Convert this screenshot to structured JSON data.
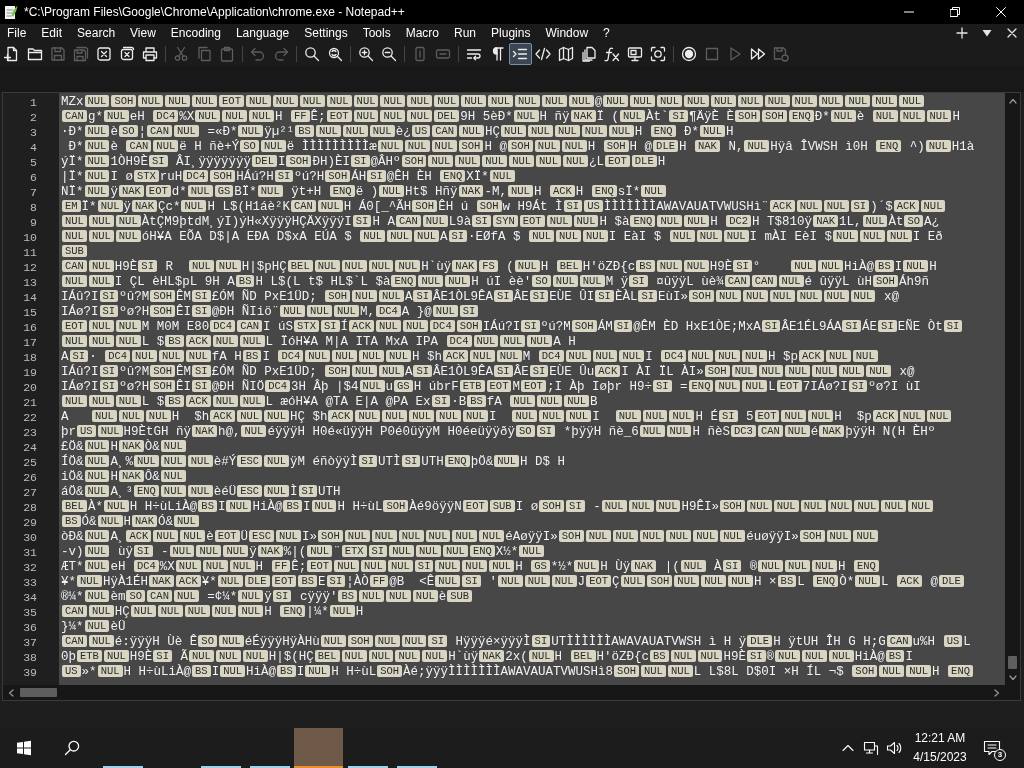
{
  "window": {
    "title": "*C:\\Program Files\\Google\\Chrome\\Application\\chrome.exe - Notepad++"
  },
  "menu": [
    "File",
    "Edit",
    "Search",
    "View",
    "Encoding",
    "Language",
    "Settings",
    "Tools",
    "Macro",
    "Run",
    "Plugins",
    "Window",
    "?"
  ],
  "toolbar": {
    "groups": [
      {
        "items": [
          {
            "kind": "new",
            "disabled": false,
            "on": false
          },
          {
            "kind": "open",
            "disabled": false,
            "on": false
          },
          {
            "kind": "save",
            "disabled": true,
            "on": false
          },
          {
            "kind": "save-all",
            "disabled": true,
            "on": false
          },
          {
            "kind": "close",
            "disabled": false,
            "on": false
          },
          {
            "kind": "close-all",
            "disabled": false,
            "on": false
          },
          {
            "kind": "print",
            "disabled": false,
            "on": false
          }
        ]
      },
      {
        "items": [
          {
            "kind": "cut",
            "disabled": true,
            "on": false
          },
          {
            "kind": "copy",
            "disabled": true,
            "on": false
          },
          {
            "kind": "paste",
            "disabled": true,
            "on": false
          }
        ]
      },
      {
        "items": [
          {
            "kind": "undo",
            "disabled": true,
            "on": false
          },
          {
            "kind": "redo",
            "disabled": true,
            "on": false
          }
        ]
      },
      {
        "items": [
          {
            "kind": "find",
            "disabled": false,
            "on": false
          },
          {
            "kind": "replace",
            "disabled": false,
            "on": false
          }
        ]
      },
      {
        "items": [
          {
            "kind": "zoom-in",
            "disabled": false,
            "on": false
          },
          {
            "kind": "zoom-out",
            "disabled": false,
            "on": false
          }
        ]
      },
      {
        "items": [
          {
            "kind": "sync-vertical",
            "disabled": true,
            "on": false
          },
          {
            "kind": "sync-horizontal",
            "disabled": true,
            "on": false
          }
        ]
      },
      {
        "items": [
          {
            "kind": "wrap",
            "disabled": false,
            "on": false
          },
          {
            "kind": "all-chars",
            "disabled": false,
            "on": false
          },
          {
            "kind": "indent-guide",
            "disabled": false,
            "on": true
          },
          {
            "kind": "tags",
            "disabled": false,
            "on": false
          },
          {
            "kind": "doc-map",
            "disabled": false,
            "on": false
          },
          {
            "kind": "doc-list",
            "disabled": false,
            "on": false
          },
          {
            "kind": "function-list",
            "disabled": false,
            "on": false
          },
          {
            "kind": "workspace",
            "disabled": false,
            "on": false
          },
          {
            "kind": "monitoring",
            "disabled": false,
            "on": false
          }
        ]
      },
      {
        "items": [
          {
            "kind": "record",
            "disabled": false,
            "on": false
          },
          {
            "kind": "stop",
            "disabled": true,
            "on": false
          },
          {
            "kind": "play",
            "disabled": true,
            "on": false
          },
          {
            "kind": "play-multiple",
            "disabled": false,
            "on": false
          },
          {
            "kind": "save-macro",
            "disabled": true,
            "on": false
          }
        ]
      }
    ]
  },
  "editor": {
    "all_selected": true,
    "lines": [
      {
        "number": "1",
        "segments": [
          "MZx",
          [
            "NUL"
          ],
          [
            "SOH"
          ],
          [
            "NUL"
          ],
          [
            "NUL"
          ],
          [
            "NUL"
          ],
          [
            "EOT"
          ],
          [
            "NUL"
          ],
          [
            "NUL"
          ],
          [
            "NUL"
          ],
          [
            "NUL"
          ],
          [
            "NUL"
          ],
          [
            "NUL"
          ],
          [
            "NUL"
          ],
          [
            "NUL"
          ],
          [
            "NUL"
          ],
          [
            "NUL"
          ],
          [
            "NUL"
          ],
          [
            "NUL"
          ],
          [
            "NUL"
          ],
          "@",
          [
            "NUL"
          ],
          [
            "NUL"
          ],
          [
            "NUL"
          ],
          [
            "NUL"
          ],
          [
            "NUL"
          ],
          [
            "NUL"
          ],
          [
            "NUL"
          ],
          [
            "NUL"
          ],
          [
            "NUL"
          ],
          [
            "NUL"
          ],
          [
            "NUL"
          ],
          [
            "NUL"
          ]
        ]
      },
      {
        "number": "2",
        "segments": [
          [
            "CAN"
          ],
          "g*",
          [
            "NUL"
          ],
          "eH ",
          [
            "DC4"
          ],
          "%X",
          [
            "NUL"
          ],
          [
            "NUL"
          ],
          [
            "NUL"
          ],
          "H ",
          [
            "FF"
          ],
          "Ê;",
          [
            "EOT"
          ],
          [
            "NUL"
          ],
          [
            "NUL"
          ],
          [
            "NUL"
          ],
          [
            "DEL"
          ],
          "9H 5èÐ*",
          [
            "NUL"
          ],
          "H ñÿ",
          [
            "NAK"
          ],
          "Ï (",
          [
            "NUL"
          ],
          "Àt`",
          [
            "SI"
          ],
          "¶ÄÿÈ È",
          [
            "SOH"
          ],
          [
            "SOH"
          ],
          [
            "ENQ"
          ],
          "Ð*",
          [
            "NUL"
          ],
          "è ",
          [
            "NUL"
          ],
          [
            "NUL"
          ],
          [
            "NUL"
          ],
          "H"
        ]
      },
      {
        "number": "3",
        "segments": [
          "·Ð*",
          [
            "NUL"
          ],
          "è",
          [
            "SO"
          ],
          "¦",
          [
            "CAN"
          ],
          [
            "NUL"
          ],
          " =«Ð*",
          [
            "NUL"
          ],
          "ÿµ²¹",
          [
            "BS"
          ],
          [
            "NUL"
          ],
          [
            "NUL"
          ],
          [
            "NUL"
          ],
          "è¿",
          [
            "US"
          ],
          [
            "CAN"
          ],
          [
            "NUL"
          ],
          "HÇ",
          [
            "NUL"
          ],
          [
            "NUL"
          ],
          [
            "NUL"
          ],
          [
            "NUL"
          ],
          [
            "NUL"
          ],
          "H ",
          [
            "ENQ"
          ],
          " Ð*",
          [
            "NUL"
          ],
          "H"
        ]
      },
      {
        "number": "4",
        "segments": [
          " Ð*",
          [
            "NUL"
          ],
          "è ",
          [
            "CAN"
          ],
          [
            "NUL"
          ],
          "ë H ñè+Ý",
          [
            "SO"
          ],
          [
            "NUL"
          ],
          "ë ÌÌÌÌÌÌÌÌÌæ",
          [
            "NUL"
          ],
          [
            "NUL"
          ],
          [
            "NUL"
          ],
          [
            "SOH"
          ],
          "H @",
          [
            "SOH"
          ],
          [
            "NUL"
          ],
          [
            "NUL"
          ],
          "H ",
          [
            "SOH"
          ],
          "H @",
          [
            "DLE"
          ],
          "H ",
          [
            "NAK"
          ],
          " N,",
          [
            "NUL"
          ],
          "Hÿâ ÎVWSH ì0H ",
          [
            "ENQ"
          ],
          " ^)",
          [
            "NUL"
          ],
          "H1à"
        ]
      },
      {
        "number": "5",
        "segments": [
          "ýÏ*",
          [
            "NUL"
          ],
          "1ÒH9È",
          [
            "SI"
          ],
          " ÂI¸ÿÿÿÿÿÿÿ",
          [
            "DEL"
          ],
          "I",
          [
            "SOH"
          ],
          "ÐH)ÈI",
          [
            "SI"
          ],
          "@ÂHº",
          [
            "SOH"
          ],
          [
            "NUL"
          ],
          [
            "NUL"
          ],
          [
            "NUL"
          ],
          [
            "NUL"
          ],
          [
            "NUL"
          ],
          [
            "NUL"
          ],
          "¿L",
          [
            "EOT"
          ],
          [
            "DLE"
          ],
          "H"
        ]
      },
      {
        "number": "6",
        "segments": [
          "|Ï*",
          [
            "NUL"
          ],
          "I ø",
          [
            "STX"
          ],
          "ruH",
          [
            "DC4"
          ],
          [
            "SOH"
          ],
          "HÁú?H",
          [
            "SI"
          ],
          "ºú?H",
          [
            "SOH"
          ],
          "ÁH",
          [
            "SI"
          ],
          "@ÊH ÈH ",
          [
            "ENQ"
          ],
          "XÏ*",
          [
            "NUL"
          ]
        ]
      },
      {
        "number": "7",
        "segments": [
          "NÏ*",
          [
            "NUL"
          ],
          "ÿ",
          [
            "NAK"
          ],
          [
            "EOT"
          ],
          "d*",
          [
            "NUL"
          ],
          [
            "GS"
          ],
          "BÏ*",
          [
            "NUL"
          ],
          " ÿt+H ",
          [
            "ENQ"
          ],
          "ë )",
          [
            "NUL"
          ],
          "Ht$ Hñÿ",
          [
            "NAK"
          ],
          "-M,",
          [
            "NUL"
          ],
          "H ",
          [
            "ACK"
          ],
          "H ",
          [
            "ENQ"
          ],
          "sÏ*",
          [
            "NUL"
          ]
        ]
      },
      {
        "number": "8",
        "segments": [
          [
            "EM"
          ],
          "Ï*",
          [
            "NUL"
          ],
          "ÿ",
          [
            "NAK"
          ],
          "Çc*",
          [
            "NUL"
          ],
          "H L$(H1áè²K",
          [
            "CAN"
          ],
          [
            "NUL"
          ],
          "H Á0[_^ÃH",
          [
            "SOH"
          ],
          "ÊH ú ",
          [
            "SOH"
          ],
          "w H9Át Ì",
          [
            "SI"
          ],
          [
            "US"
          ],
          "ÌÌÌÌÌÌÌAWAVAUATVWUSHì¨",
          [
            "ACK"
          ],
          [
            "NUL"
          ],
          [
            "NUL"
          ],
          [
            "SI"
          ],
          ")´$",
          [
            "ACK"
          ],
          [
            "NUL"
          ]
        ]
      },
      {
        "number": "9",
        "segments": [
          [
            "NUL"
          ],
          [
            "NUL"
          ],
          [
            "NUL"
          ],
          "ÀtÇM9þtdM¸ýI)ýH«XÿÿÿHÇÄXÿÿÿI",
          [
            "SI"
          ],
          "H A",
          [
            "CAN"
          ],
          [
            "NUL"
          ],
          "L9à",
          [
            "SI"
          ],
          [
            "SYN"
          ],
          [
            "EOT"
          ],
          [
            "NUL"
          ],
          [
            "NUL"
          ],
          "H $à",
          [
            "ENQ"
          ],
          [
            "NUL"
          ],
          [
            "NUL"
          ],
          "H ",
          [
            "DC2"
          ],
          "H T$810ÿ",
          [
            "NAK"
          ],
          "1L,",
          [
            "NUL"
          ],
          "Àt",
          [
            "SO"
          ],
          "A¿"
        ]
      },
      {
        "number": "10",
        "segments": [
          [
            "NUL"
          ],
          [
            "NUL"
          ],
          [
            "NUL"
          ],
          "óH¥A EÕA D$|A EÐA D$xA EÚA $ ",
          [
            "NUL"
          ],
          [
            "NUL"
          ],
          [
            "NUL"
          ],
          "A",
          [
            "SI"
          ],
          "·EØfA $ ",
          [
            "NUL"
          ],
          [
            "NUL"
          ],
          [
            "NUL"
          ],
          "I EàI $ ",
          [
            "NUL"
          ],
          [
            "NUL"
          ],
          [
            "NUL"
          ],
          "I mÀI EèI $",
          [
            "NUL"
          ],
          [
            "NUL"
          ],
          [
            "NUL"
          ],
          "I Eð"
        ]
      },
      {
        "number": "11",
        "segments": [
          [
            "SUB"
          ]
        ]
      },
      {
        "number": "12",
        "segments": [
          [
            "CAN"
          ],
          [
            "NUL"
          ],
          "H9È",
          [
            "SI"
          ],
          " R  ",
          [
            "NUL"
          ],
          [
            "NUL"
          ],
          "H|$pHÇ",
          [
            "BEL"
          ],
          [
            "NUL"
          ],
          [
            "NUL"
          ],
          [
            "NUL"
          ],
          [
            "NUL"
          ],
          "H`ùÿ",
          [
            "NAK"
          ],
          [
            "FS"
          ],
          " (",
          [
            "NUL"
          ],
          "H ",
          [
            "BEL"
          ],
          "H'öZÐ{c",
          [
            "BS"
          ],
          [
            "NUL"
          ],
          [
            "NUL"
          ],
          "H9È",
          [
            "SI"
          ],
          "°    ",
          [
            "NUL"
          ],
          [
            "NUL"
          ],
          "HiÀ@",
          [
            "BS"
          ],
          "I",
          [
            "NUL"
          ],
          "H"
        ]
      },
      {
        "number": "13",
        "segments": [
          [
            "NUL"
          ],
          [
            "NUL"
          ],
          "I ÇL èHL$pL 9H A",
          [
            "BS"
          ],
          "H L$(L t$ HL$`L $à",
          [
            "ENQ"
          ],
          [
            "NUL"
          ],
          [
            "NUL"
          ],
          "H úI èè'",
          [
            "SO"
          ],
          [
            "NUL"
          ],
          [
            "NUL"
          ],
          "M ÿ",
          [
            "SI"
          ],
          " ¤ûÿÿL ùè¾",
          [
            "CAN"
          ],
          [
            "CAN"
          ],
          [
            "NUL"
          ],
          "é ûÿÿL ùH",
          [
            "SOH"
          ],
          "Áh9ñ"
        ]
      },
      {
        "number": "14",
        "segments": [
          "IÁû?I",
          [
            "SI"
          ],
          "ºû?M",
          [
            "SOH"
          ],
          "ÊM",
          [
            "SI"
          ],
          "£ÓM ÑD PxE1ÜD; ",
          [
            "SOH"
          ],
          [
            "NUL"
          ],
          [
            "NUL"
          ],
          "A",
          [
            "SI"
          ],
          "ÂE1ÒL9ÊA",
          [
            "SI"
          ],
          "ÂE",
          [
            "SI"
          ],
          "EÙE ÛI",
          [
            "SI"
          ],
          "ÈÀL",
          [
            "SI"
          ],
          "EùI»",
          [
            "SOH"
          ],
          [
            "NUL"
          ],
          [
            "NUL"
          ],
          [
            "NUL"
          ],
          [
            "NUL"
          ],
          [
            "NUL"
          ],
          [
            "NUL"
          ],
          " x@"
        ]
      },
      {
        "number": "15",
        "segments": [
          "IÁø?I",
          [
            "SI"
          ],
          "ºø?H",
          [
            "SOH"
          ],
          "ÊI",
          [
            "SI"
          ],
          "@ÐH ÑIiö¨",
          [
            "NUL"
          ],
          [
            "NUL"
          ],
          [
            "NUL"
          ],
          "M,",
          [
            "DC4"
          ],
          "A }@",
          [
            "NUL"
          ],
          [
            "SI"
          ]
        ]
      },
      {
        "number": "16",
        "segments": [
          [
            "EOT"
          ],
          [
            "NUL"
          ],
          [
            "NUL"
          ],
          "M M0M E80",
          [
            "DC4"
          ],
          [
            "CAN"
          ],
          "I úS",
          [
            "STX"
          ],
          [
            "SI"
          ],
          "Í",
          [
            "ACK"
          ],
          [
            "NUL"
          ],
          [
            "NUL"
          ],
          [
            "DC4"
          ],
          [
            "SOH"
          ],
          "IÁú?I",
          [
            "SI"
          ],
          "ºú?M",
          [
            "SOH"
          ],
          "ÁM",
          [
            "SI"
          ],
          "@ÊM ÈD HxE1ÒE;MxA",
          [
            "SI"
          ],
          "ÂE1ÉL9ÁA",
          [
            "SI"
          ],
          "ÁE",
          [
            "SI"
          ],
          "EÑE Òt",
          [
            "SI"
          ]
        ]
      },
      {
        "number": "17",
        "segments": [
          [
            "NUL"
          ],
          [
            "NUL"
          ],
          [
            "NUL"
          ],
          "L $",
          [
            "BS"
          ],
          [
            "ACK"
          ],
          [
            "NUL"
          ],
          [
            "NUL"
          ],
          "L ÏóH¥A M|A ITA MxA IPA ",
          [
            "DC4"
          ],
          [
            "NUL"
          ],
          [
            "NUL"
          ],
          [
            "NUL"
          ],
          "A H"
        ]
      },
      {
        "number": "18",
        "segments": [
          "A",
          [
            "SI"
          ],
          "· ",
          [
            "DC4"
          ],
          [
            "NUL"
          ],
          [
            "NUL"
          ],
          [
            "NUL"
          ],
          "fA H",
          [
            "BS"
          ],
          "I ",
          [
            "DC4"
          ],
          [
            "NUL"
          ],
          [
            "NUL"
          ],
          [
            "NUL"
          ],
          [
            "NUL"
          ],
          "H $h",
          [
            "ACK"
          ],
          [
            "NUL"
          ],
          [
            "NUL"
          ],
          "M ",
          [
            "DC4"
          ],
          [
            "NUL"
          ],
          [
            "NUL"
          ],
          [
            "NUL"
          ],
          "I ",
          [
            "DC4"
          ],
          [
            "NUL"
          ],
          [
            "NUL"
          ],
          [
            "NUL"
          ],
          "H $p",
          [
            "ACK"
          ],
          [
            "NUL"
          ],
          [
            "NUL"
          ]
        ]
      },
      {
        "number": "19",
        "segments": [
          "IÁû?I",
          [
            "SI"
          ],
          "ºû?M",
          [
            "SOH"
          ],
          "ÊM",
          [
            "SI"
          ],
          "£ÓM ÑD PxE1ÜD; ",
          [
            "SOH"
          ],
          [
            "NUL"
          ],
          [
            "NUL"
          ],
          "A",
          [
            "SI"
          ],
          "ÂE1ÒL9ÊA",
          [
            "SI"
          ],
          "ÂE",
          [
            "SI"
          ],
          "EÙE Ûu",
          [
            "ACK"
          ],
          "I ÀI ÏL ÀI»",
          [
            "SOH"
          ],
          [
            "NUL"
          ],
          [
            "NUL"
          ],
          [
            "NUL"
          ],
          [
            "NUL"
          ],
          [
            "NUL"
          ],
          [
            "NUL"
          ],
          " x@"
        ]
      },
      {
        "number": "20",
        "segments": [
          "IÁø?I",
          [
            "SI"
          ],
          "ºø?H",
          [
            "SOH"
          ],
          "ÊI",
          [
            "SI"
          ],
          "@ÐH ÑIÖ",
          [
            "DC4"
          ],
          "3H Âþ |$4",
          [
            "NUL"
          ],
          "u",
          [
            "GS"
          ],
          "H úbrF",
          [
            "ETB"
          ],
          [
            "EOT"
          ],
          "M",
          [
            "EOT"
          ],
          ";I Àþ Iøþr H9÷",
          [
            "SI"
          ],
          " =",
          [
            "ENQ"
          ],
          [
            "NUL"
          ],
          [
            "NUL"
          ],
          "L",
          [
            "EOT"
          ],
          "7IÁø?I",
          [
            "SI"
          ],
          "ºø?I ùI"
        ]
      },
      {
        "number": "21",
        "segments": [
          [
            "NUL"
          ],
          [
            "NUL"
          ],
          [
            "NUL"
          ],
          "L $",
          [
            "BS"
          ],
          [
            "ACK"
          ],
          [
            "NUL"
          ],
          [
            "NUL"
          ],
          "L æóH¥A @TA E|A @PA Ex",
          [
            "SI"
          ],
          "·B",
          [
            "BS"
          ],
          "fA ",
          [
            "NUL"
          ],
          [
            "NUL"
          ],
          [
            "NUL"
          ],
          "B"
        ]
      },
      {
        "number": "22",
        "segments": [
          "A   ",
          [
            "NUL"
          ],
          [
            "NUL"
          ],
          [
            "NUL"
          ],
          "H  $h",
          [
            "ACK"
          ],
          [
            "NUL"
          ],
          [
            "NUL"
          ],
          "HÇ $h",
          [
            "ACK"
          ],
          [
            "NUL"
          ],
          [
            "NUL"
          ],
          [
            "NUL"
          ],
          [
            "NUL"
          ],
          [
            "NUL"
          ],
          "I  ",
          [
            "NUL"
          ],
          [
            "NUL"
          ],
          [
            "NUL"
          ],
          "I  ",
          [
            "NUL"
          ],
          [
            "NUL"
          ],
          [
            "NUL"
          ],
          "H É",
          [
            "SI"
          ],
          " 5",
          [
            "EOT"
          ],
          [
            "NUL"
          ],
          [
            "NUL"
          ],
          "H  $p",
          [
            "ACK"
          ],
          [
            "NUL"
          ],
          [
            "NUL"
          ]
        ]
      },
      {
        "number": "23",
        "segments": [
          "þr",
          [
            "US"
          ],
          [
            "NUL"
          ],
          "H9ÈtGH ñÿ",
          [
            "NAK"
          ],
          "h@,",
          [
            "NUL"
          ],
          "éÿÿÿH H0é«üÿÿH P0é0üÿÿM H0éeüÿÿðÿ",
          [
            "SO"
          ],
          [
            "SI"
          ],
          " *þÿÿH ñè_6",
          [
            "NUL"
          ],
          [
            "NUL"
          ],
          "H ñèS",
          [
            "DC3"
          ],
          [
            "CAN"
          ],
          [
            "NUL"
          ],
          "é",
          [
            "NAK"
          ],
          "þÿÿH N(H ÈHº"
        ]
      },
      {
        "number": "24",
        "segments": [
          "£Ö&",
          [
            "NUL"
          ],
          "H",
          [
            "NAK"
          ],
          "Ò&",
          [
            "NUL"
          ]
        ]
      },
      {
        "number": "25",
        "segments": [
          "ÍÖ&",
          [
            "NUL"
          ],
          "A¸%",
          [
            "NUL"
          ],
          [
            "NUL"
          ],
          [
            "NUL"
          ],
          "è#Ý",
          [
            "ESC"
          ],
          [
            "NUL"
          ],
          "ÿM éñòÿÿÌ",
          [
            "SI"
          ],
          "UTÌ",
          [
            "SI"
          ],
          "UTH",
          [
            "ENQ"
          ],
          "þÖ&",
          [
            "NUL"
          ],
          "H D$ H"
        ]
      },
      {
        "number": "26",
        "segments": [
          "iÖ&",
          [
            "NUL"
          ],
          "H",
          [
            "NAK"
          ],
          "Ô&",
          [
            "NUL"
          ]
        ]
      },
      {
        "number": "27",
        "segments": [
          "áÖ&",
          [
            "NUL"
          ],
          "A¸³",
          [
            "ENQ"
          ],
          [
            "NUL"
          ],
          [
            "NUL"
          ],
          "èéÜ",
          [
            "ESC"
          ],
          [
            "NUL"
          ],
          "Ì",
          [
            "SI"
          ],
          "UTH"
        ]
      },
      {
        "number": "28",
        "segments": [
          [
            "BEL"
          ],
          "À*",
          [
            "NUL"
          ],
          "H H÷ùLiÀ@",
          [
            "BS"
          ],
          "I",
          [
            "NUL"
          ],
          "HiÀ@",
          [
            "BS"
          ],
          "I",
          [
            "NUL"
          ],
          "H H÷ùL",
          [
            "SOH"
          ],
          "Àé9öÿÿN",
          [
            "EOT"
          ],
          [
            "SUB"
          ],
          "I ø",
          [
            "SOH"
          ],
          [
            "SI"
          ],
          " -",
          [
            "NUL"
          ],
          [
            "NUL"
          ],
          [
            "NUL"
          ],
          "H9ÊI»",
          [
            "SOH"
          ],
          [
            "NUL"
          ],
          [
            "NUL"
          ],
          [
            "NUL"
          ],
          [
            "NUL"
          ],
          [
            "NUL"
          ],
          [
            "NUL"
          ],
          [
            "NUL"
          ]
        ]
      },
      {
        "number": "29",
        "segments": [
          [
            "BS"
          ],
          "Ó&",
          [
            "NUL"
          ],
          "H",
          [
            "NAK"
          ],
          "Ó&",
          [
            "NUL"
          ]
        ]
      },
      {
        "number": "30",
        "segments": [
          "òÐ&",
          [
            "NUL"
          ],
          "A¸",
          [
            "ACK"
          ],
          [
            "NUL"
          ],
          [
            "NUL"
          ],
          "è",
          [
            "EOT"
          ],
          "Ü",
          [
            "ESC"
          ],
          [
            "NUL"
          ],
          "I»",
          [
            "SOH"
          ],
          [
            "NUL"
          ],
          [
            "NUL"
          ],
          [
            "NUL"
          ],
          [
            "NUL"
          ],
          [
            "NUL"
          ],
          [
            "NUL"
          ],
          "éAøÿÿI»",
          [
            "SOH"
          ],
          [
            "NUL"
          ],
          [
            "NUL"
          ],
          [
            "NUL"
          ],
          [
            "NUL"
          ],
          [
            "NUL"
          ],
          [
            "NUL"
          ],
          "éuøÿÿI»",
          [
            "SOH"
          ],
          [
            "NUL"
          ],
          [
            "NUL"
          ]
        ]
      },
      {
        "number": "31",
        "segments": [
          "-v)",
          [
            "NUL"
          ],
          " ùÿ",
          [
            "SI"
          ],
          " -",
          [
            "NUL"
          ],
          [
            "NUL"
          ],
          [
            "NUL"
          ],
          "ÿ",
          [
            "NAK"
          ],
          "%|(",
          [
            "NUL"
          ],
          "¨",
          [
            "ETX"
          ],
          [
            "SI"
          ],
          [
            "NUL"
          ],
          [
            "NUL"
          ],
          [
            "NUL"
          ],
          [
            "ENQ"
          ],
          "X½*",
          [
            "NUL"
          ]
        ]
      },
      {
        "number": "32",
        "segments": [
          "ÆT*",
          [
            "NUL"
          ],
          "eH ",
          [
            "DC4"
          ],
          "%X",
          [
            "NUL"
          ],
          [
            "NUL"
          ],
          [
            "NUL"
          ],
          "H ",
          [
            "FF"
          ],
          "Ê;",
          [
            "EOT"
          ],
          [
            "NUL"
          ],
          [
            "NUL"
          ],
          [
            "NUL"
          ],
          [
            "SI"
          ],
          [
            "NUL"
          ],
          [
            "NUL"
          ],
          [
            "NUL"
          ],
          "H ",
          [
            "GS"
          ],
          "*½*",
          [
            "NUL"
          ],
          "H Ùÿ",
          [
            "NAK"
          ],
          " |(",
          [
            "NUL"
          ],
          " À",
          [
            "SI"
          ],
          " ®",
          [
            "NUL"
          ],
          [
            "NUL"
          ],
          [
            "NUL"
          ],
          "H ",
          [
            "ENQ"
          ]
        ]
      },
      {
        "number": "33",
        "segments": [
          "¥*",
          [
            "NUL"
          ],
          "HÿÀ1ÉH",
          [
            "NAK"
          ],
          [
            "ACK"
          ],
          "¥*",
          [
            "NUL"
          ],
          [
            "DLE"
          ],
          [
            "EOT"
          ],
          [
            "BS"
          ],
          "E",
          [
            "SI"
          ],
          "¦ÀÒ",
          [
            "FF"
          ],
          "@B  <Ê",
          [
            "NUL"
          ],
          [
            "SI"
          ],
          " '",
          [
            "NUL"
          ],
          [
            "NUL"
          ],
          [
            "NUL"
          ],
          "J",
          [
            "EOT"
          ],
          "Ç",
          [
            "NUL"
          ],
          [
            "SOH"
          ],
          [
            "NUL"
          ],
          [
            "NUL"
          ],
          [
            "NUL"
          ],
          "H ×",
          [
            "BS"
          ],
          "L ",
          [
            "ENQ"
          ],
          "Ò*",
          [
            "NUL"
          ],
          "L ",
          [
            "ACK"
          ],
          " @",
          [
            "DLE"
          ]
        ]
      },
      {
        "number": "34",
        "segments": [
          "®¼*",
          [
            "NUL"
          ],
          "èm",
          [
            "SO"
          ],
          [
            "CAN"
          ],
          [
            "NUL"
          ],
          " =¢¼*",
          [
            "NUL"
          ],
          "ÿ",
          [
            "SI"
          ],
          " cÿÿÿ'",
          [
            "BS"
          ],
          [
            "NUL"
          ],
          [
            "NUL"
          ],
          [
            "NUL"
          ],
          "è",
          [
            "SUB"
          ]
        ]
      },
      {
        "number": "35",
        "segments": [
          [
            "CAN"
          ],
          [
            "NUL"
          ],
          "HÇ",
          [
            "NUL"
          ],
          [
            "NUL"
          ],
          [
            "NUL"
          ],
          [
            "NUL"
          ],
          [
            "NUL"
          ],
          "H ",
          [
            "ENQ"
          ],
          "|¼*",
          [
            "NUL"
          ],
          "H"
        ]
      },
      {
        "number": "36",
        "segments": [
          "}¼*",
          [
            "NUL"
          ],
          "èÜ"
        ]
      },
      {
        "number": "37",
        "segments": [
          [
            "CAN"
          ],
          [
            "NUL"
          ],
          "é:ÿÿÿH Ùè Ê",
          [
            "SO"
          ],
          [
            "NUL"
          ],
          "éÉÿÿÿHÿÀHù",
          [
            "NUL"
          ],
          [
            "SOH"
          ],
          [
            "NUL"
          ],
          [
            "NUL"
          ],
          [
            "SI"
          ],
          " Hÿÿÿé×ÿÿÿÌ",
          [
            "SI"
          ],
          "UTÌÌÌÌÌÌAWAVAUATVWSH ì H ÿ",
          [
            "DLE"
          ],
          "H ÿtUH ÎH G H;G",
          [
            "CAN"
          ],
          "u%H ",
          [
            "US"
          ],
          "L"
        ]
      },
      {
        "number": "38",
        "segments": [
          "0þ",
          [
            "ETB"
          ],
          [
            "NUL"
          ],
          "H9È",
          [
            "SI"
          ],
          " Ã",
          [
            "NUL"
          ],
          [
            "NUL"
          ],
          [
            "NUL"
          ],
          "H|$(HÇ",
          [
            "BEL"
          ],
          [
            "NUL"
          ],
          [
            "NUL"
          ],
          [
            "NUL"
          ],
          [
            "NUL"
          ],
          "H`ùÿ",
          [
            "NAK"
          ],
          "2x(",
          [
            "NUL"
          ],
          "H ",
          [
            "BEL"
          ],
          "H'öZÐ{c",
          [
            "BS"
          ],
          [
            "NUL"
          ],
          [
            "NUL"
          ],
          "H9È",
          [
            "SI"
          ],
          "®",
          [
            "NUL"
          ],
          [
            "NUL"
          ],
          [
            "NUL"
          ],
          "HiÀ@",
          [
            "BS"
          ],
          "I"
        ]
      },
      {
        "number": "39",
        "segments": [
          [
            "US"
          ],
          "»*",
          [
            "NUL"
          ],
          "H H÷ùLiÀ@",
          [
            "BS"
          ],
          "I",
          [
            "NUL"
          ],
          "HiÀ@",
          [
            "BS"
          ],
          "I",
          [
            "NUL"
          ],
          "H H÷ùL",
          [
            "SOH"
          ],
          "Àé;ÿÿÿÌÌÌÌÌÌÌAWAVAUATVWUSHì8",
          [
            "SOH"
          ],
          [
            "NUL"
          ],
          [
            "NUL"
          ],
          "L L$8L D$0I ×H ÍL ¬$ ",
          [
            "SOH"
          ],
          [
            "NUL"
          ],
          [
            "NUL"
          ],
          "H ",
          [
            "ENQ"
          ]
        ]
      }
    ]
  },
  "taskbar": {
    "apps": [
      {
        "running": true,
        "active": false
      },
      {
        "running": true,
        "active": false
      },
      {
        "running": true,
        "active": false
      },
      {
        "running": true,
        "active": true
      },
      {
        "running": true,
        "active": false
      },
      {
        "running": true,
        "active": false
      }
    ],
    "time": "12:21 AM",
    "date": "4/15/2023",
    "notification_count": "3"
  }
}
